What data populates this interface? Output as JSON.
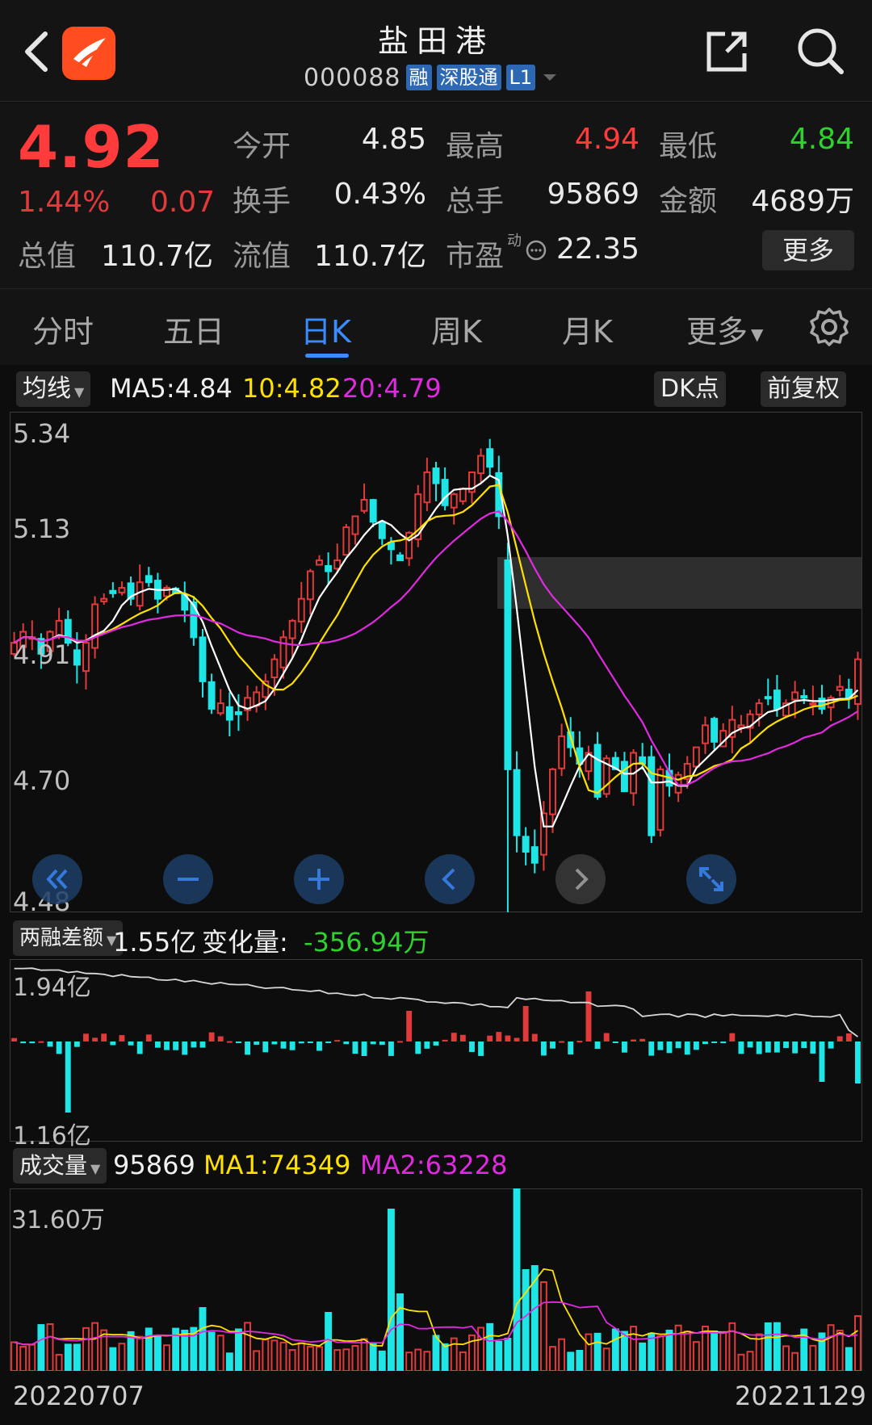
{
  "header": {
    "title": "盐田港",
    "code": "000088",
    "tags": [
      "融",
      "深股通",
      "L1"
    ]
  },
  "quote": {
    "price": "4.92",
    "change_pct": "1.44%",
    "change": "0.07",
    "fields": {
      "open_label": "今开",
      "open": "4.85",
      "high_label": "最高",
      "high": "4.94",
      "low_label": "最低",
      "low": "4.84",
      "turnover_label": "换手",
      "turnover": "0.43%",
      "volume_label": "总手",
      "volume": "95869",
      "amount_label": "金额",
      "amount": "4689万",
      "mktcap_label": "总值",
      "mktcap": "110.7亿",
      "float_label": "流值",
      "float": "110.7亿",
      "pe_label": "市盈",
      "pe_superscript": "动",
      "pe": "22.35"
    },
    "more_label": "更多"
  },
  "tabs": [
    {
      "label": "分时",
      "active": false
    },
    {
      "label": "五日",
      "active": false
    },
    {
      "label": "日K",
      "active": true
    },
    {
      "label": "周K",
      "active": false
    },
    {
      "label": "月K",
      "active": false
    },
    {
      "label": "更多",
      "active": false
    }
  ],
  "kline_panel": {
    "indicator_select": "均线",
    "ma5": "MA5:4.84",
    "ma10": "10:4.82",
    "ma20": "20:4.79",
    "dk_button": "DK点",
    "adjust_button": "前复权",
    "y_ticks": [
      "5.34",
      "5.13",
      "4.91",
      "4.70",
      "4.48"
    ]
  },
  "margin_panel": {
    "indicator_select": "两融差额",
    "value": "1.55亿",
    "change_label": "变化量:",
    "change_value": "-356.94万",
    "y_ticks": [
      "1.94亿",
      "1.16亿"
    ]
  },
  "volume_panel": {
    "indicator_select": "成交量",
    "value": "95869",
    "ma1": "MA1:74349",
    "ma2": "MA2:63228",
    "y_top": "31.60万"
  },
  "dates": {
    "start": "20220707",
    "end": "20221129"
  },
  "colors": {
    "up": "#e03a3a",
    "down": "#1ee6e6",
    "ma5": "#ffffff",
    "ma10": "#ffe100",
    "ma20": "#e02ae0",
    "accent": "#3b8cff"
  },
  "chart_data": {
    "type": "candlestick",
    "closes": [
      4.95,
      4.97,
      4.96,
      4.93,
      4.97,
      4.99,
      4.95,
      4.91,
      4.95,
      5.02,
      5.03,
      5.04,
      5.05,
      5.03,
      5.06,
      5.06,
      5.03,
      5.05,
      5.04,
      5.01,
      4.96,
      4.88,
      4.83,
      4.84,
      4.81,
      4.82,
      4.85,
      4.86,
      4.88,
      4.92,
      4.96,
      4.99,
      5.03,
      5.08,
      5.1,
      5.08,
      5.1,
      5.16,
      5.18,
      5.21,
      5.17,
      5.14,
      5.12,
      5.1,
      5.15,
      5.22,
      5.26,
      5.24,
      5.2,
      5.22,
      5.23,
      5.26,
      5.29,
      5.27,
      5.18,
      4.72,
      4.6,
      4.57,
      4.55,
      4.64,
      4.72,
      4.78,
      4.76,
      4.73,
      4.75,
      4.67,
      4.74,
      4.72,
      4.68,
      4.75,
      4.73,
      4.6,
      4.72,
      4.69,
      4.71,
      4.73,
      4.76,
      4.8,
      4.77,
      4.79,
      4.81,
      4.8,
      4.82,
      4.84,
      4.85,
      4.83,
      4.84,
      4.86,
      4.85,
      4.84,
      4.83,
      4.85,
      4.87,
      4.85,
      4.92
    ],
    "ma5": "MA5:4.84",
    "ma10": "10:4.82",
    "ma20": "20:4.79"
  }
}
